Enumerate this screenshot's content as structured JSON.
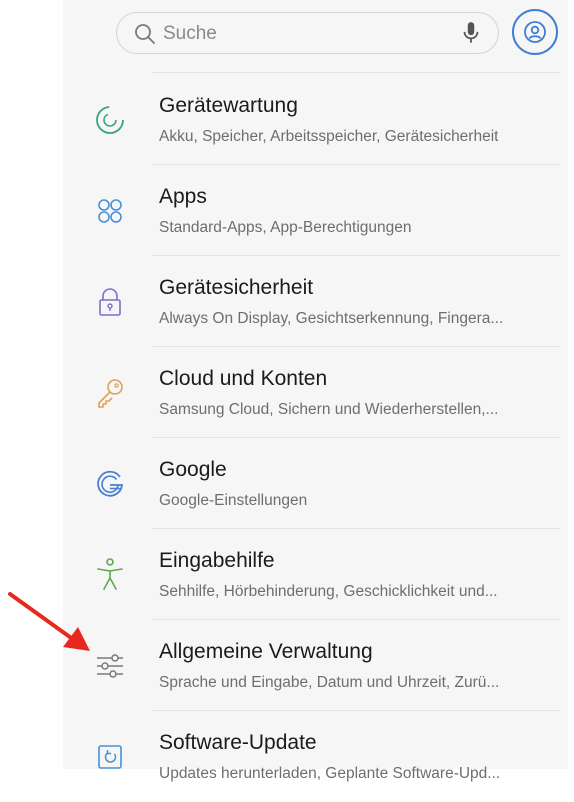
{
  "search": {
    "placeholder": "Suche",
    "icon": "search-icon",
    "mic_icon": "mic-icon",
    "profile_icon": "profile-icon",
    "accent_color": "#3e7fd6"
  },
  "settings": {
    "items": [
      {
        "title": "Gerätewartung",
        "subtitle": "Akku, Speicher, Arbeitsspeicher, Gerätesicherheit",
        "icon": "device-care-icon",
        "color": "#3aa57d"
      },
      {
        "title": "Apps",
        "subtitle": "Standard-Apps, App-Berechtigungen",
        "icon": "apps-icon",
        "color": "#4a8fd9"
      },
      {
        "title": "Gerätesicherheit",
        "subtitle": "Always On Display, Gesichtserkennung, Fingera...",
        "icon": "lock-icon",
        "color": "#7b6fcf"
      },
      {
        "title": "Cloud und Konten",
        "subtitle": "Samsung Cloud, Sichern und Wiederherstellen,...",
        "icon": "key-icon",
        "color": "#e0a05a"
      },
      {
        "title": "Google",
        "subtitle": "Google-Einstellungen",
        "icon": "google-icon",
        "color": "#4a7fd0"
      },
      {
        "title": "Eingabehilfe",
        "subtitle": "Sehhilfe, Hörbehinderung, Geschicklichkeit und...",
        "icon": "accessibility-icon",
        "color": "#5fa84a"
      },
      {
        "title": "Allgemeine Verwaltung",
        "subtitle": "Sprache und Eingabe, Datum und Uhrzeit, Zurü...",
        "icon": "sliders-icon",
        "color": "#7a7a7a"
      },
      {
        "title": "Software-Update",
        "subtitle": "Updates herunterladen, Geplante Software-Upd...",
        "icon": "software-update-icon",
        "color": "#4a8fd9"
      }
    ]
  },
  "annotation": {
    "icon": "red-arrow-icon",
    "color": "#e8281e"
  }
}
